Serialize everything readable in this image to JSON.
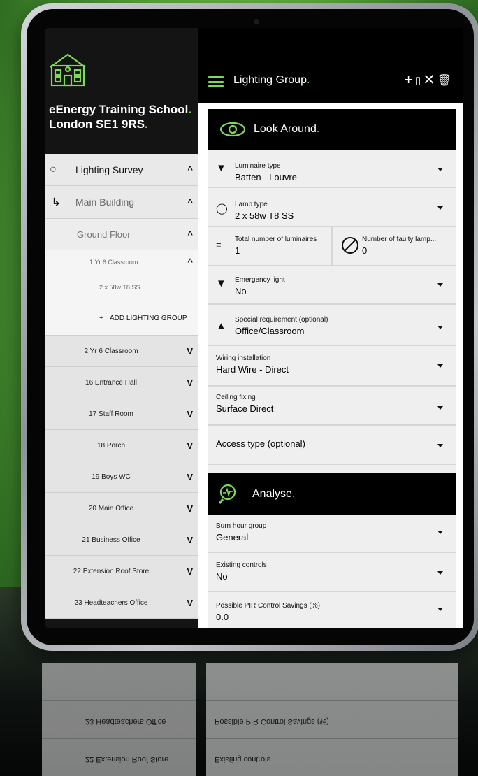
{
  "sidebar": {
    "school_name": "eEnergy Training School",
    "school_address": "London SE1 9RS",
    "dot": ".",
    "tree": {
      "survey": {
        "label": "Lighting Survey",
        "chevron": "^"
      },
      "building": {
        "label": "Main Building",
        "chevron": "^"
      },
      "floor": {
        "label": "Ground Floor",
        "chevron": "^"
      },
      "room": {
        "label": "1 Yr 6 Classroom",
        "chevron": "^"
      },
      "lamp_group": {
        "label": "2 x 58w T8 SS"
      },
      "add": {
        "label": "ADD LIGHTING GROUP",
        "icon": "+"
      },
      "other_rooms": [
        {
          "label": "2 Yr 6 Classroom"
        },
        {
          "label": "16 Entrance Hall"
        },
        {
          "label": "17 Staff Room"
        },
        {
          "label": "18 Porch"
        },
        {
          "label": "19 Boys WC"
        },
        {
          "label": "20 Main Office"
        },
        {
          "label": "21 Business Office"
        },
        {
          "label": "22 Extension Roof Store"
        },
        {
          "label": "23 Headteachers Office"
        }
      ],
      "collapsed_chevron": "V"
    }
  },
  "header": {
    "title": "Lighting Group",
    "dot": ".",
    "icons": [
      "+",
      "▯",
      "✕",
      "🗑"
    ]
  },
  "look_around": {
    "title": "Look Around",
    "fields": {
      "luminaire_type": {
        "label": "Luminaire type",
        "value": "Batten - Louvre"
      },
      "lamp_type": {
        "label": "Lamp type",
        "value": "2 x 58w T8 SS"
      },
      "total_luminaires": {
        "label": "Total number of luminaires",
        "value": "1"
      },
      "faulty_lamps": {
        "label": "Number of faulty lamp...",
        "value": "0"
      },
      "emergency_light": {
        "label": "Emergency light",
        "value": "No"
      },
      "special_requirement": {
        "label": "Special requirement (optional)",
        "value": "Office/Classroom"
      },
      "wiring_installation": {
        "label": "Wiring installation",
        "value": "Hard Wire - Direct"
      },
      "ceiling_fixing": {
        "label": "Ceiling fixing",
        "value": "Surface Direct"
      },
      "access_type": {
        "label": "Access type (optional)"
      }
    }
  },
  "analyse": {
    "title": "Analyse",
    "fields": {
      "burn_hour_group": {
        "label": "Burn hour group",
        "value": "General"
      },
      "existing_controls": {
        "label": "Existing controls",
        "value": "No"
      },
      "pir_savings": {
        "label": "Possible PIR Control Savings (%)",
        "value": "0.0"
      }
    }
  },
  "colors": {
    "accent": "#7ed957",
    "panel_dark": "#141414",
    "field_bg": "#efefef"
  }
}
